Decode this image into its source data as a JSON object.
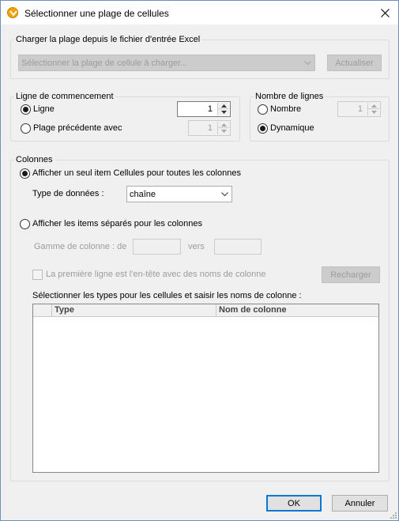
{
  "window": {
    "title": "Sélectionner une plage de cellules"
  },
  "load_group": {
    "legend": "Charger la plage depuis le fichier d'entrée Excel",
    "combo_placeholder": "Sélectionner la plage de cellule à charger...",
    "refresh_label": "Actualiser"
  },
  "start_group": {
    "legend": "Ligne de commencement",
    "row_label": "Ligne",
    "row_value": "1",
    "previous_label": "Plage précédente avec",
    "previous_value": "1"
  },
  "count_group": {
    "legend": "Nombre de lignes",
    "number_label": "Nombre",
    "number_value": "1",
    "dynamic_label": "Dynamique"
  },
  "columns_group": {
    "legend": "Colonnes",
    "single_item_label": "Afficher un seul item Cellules pour toutes les colonnes",
    "data_type_label": "Type de données :",
    "data_type_value": "chaîne",
    "separate_items_label": "Afficher les items séparés pour les colonnes",
    "range_from_label": "Gamme de colonne : de",
    "range_to_label": "vers",
    "header_row_label": "La première ligne est l'en-tête avec des noms de colonne",
    "reload_label": "Recharger",
    "types_caption": "Sélectionner les types pour les cellules et saisir les noms de colonne :",
    "table_columns": [
      "Type",
      "Nom de colonne"
    ]
  },
  "footer": {
    "ok_label": "OK",
    "cancel_label": "Annuler"
  },
  "colors": {
    "accent": "#0078d7",
    "app_icon": "#f2a400"
  }
}
